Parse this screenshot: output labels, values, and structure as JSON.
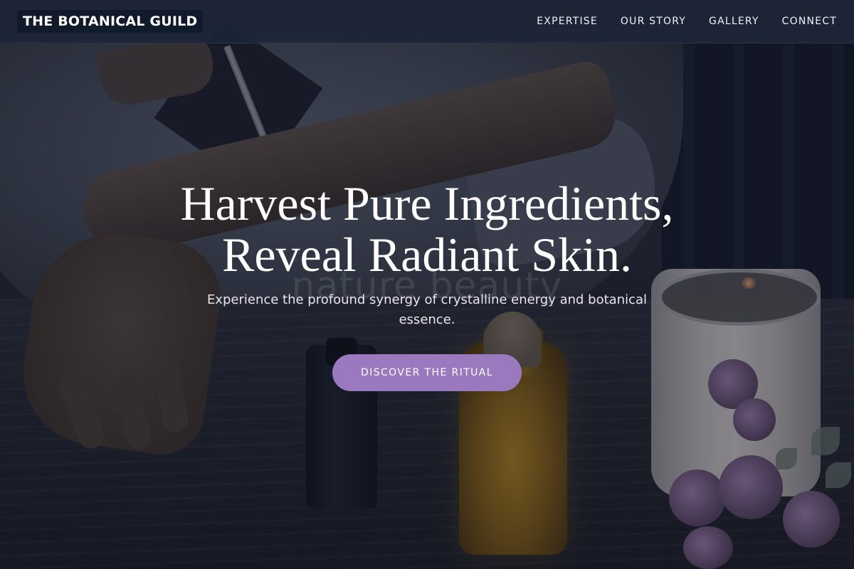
{
  "brand": {
    "name": "THE BOTANICAL GUILD"
  },
  "nav": {
    "items": [
      {
        "label": "EXPERTISE"
      },
      {
        "label": "OUR STORY"
      },
      {
        "label": "GALLERY"
      },
      {
        "label": "CONNECT"
      }
    ]
  },
  "hero": {
    "headline_line1": "Harvest Pure Ingredients,",
    "headline_line2": "Reveal Radiant Skin.",
    "ghost_text": "nature beauty",
    "subtitle": "Experience the profound synergy of crystalline energy and botanical essence.",
    "cta_label": "DISCOVER THE RITUAL"
  },
  "colors": {
    "accent": "#9b79be",
    "navbar": "#1c2536",
    "brand_bg": "#111a2b"
  }
}
